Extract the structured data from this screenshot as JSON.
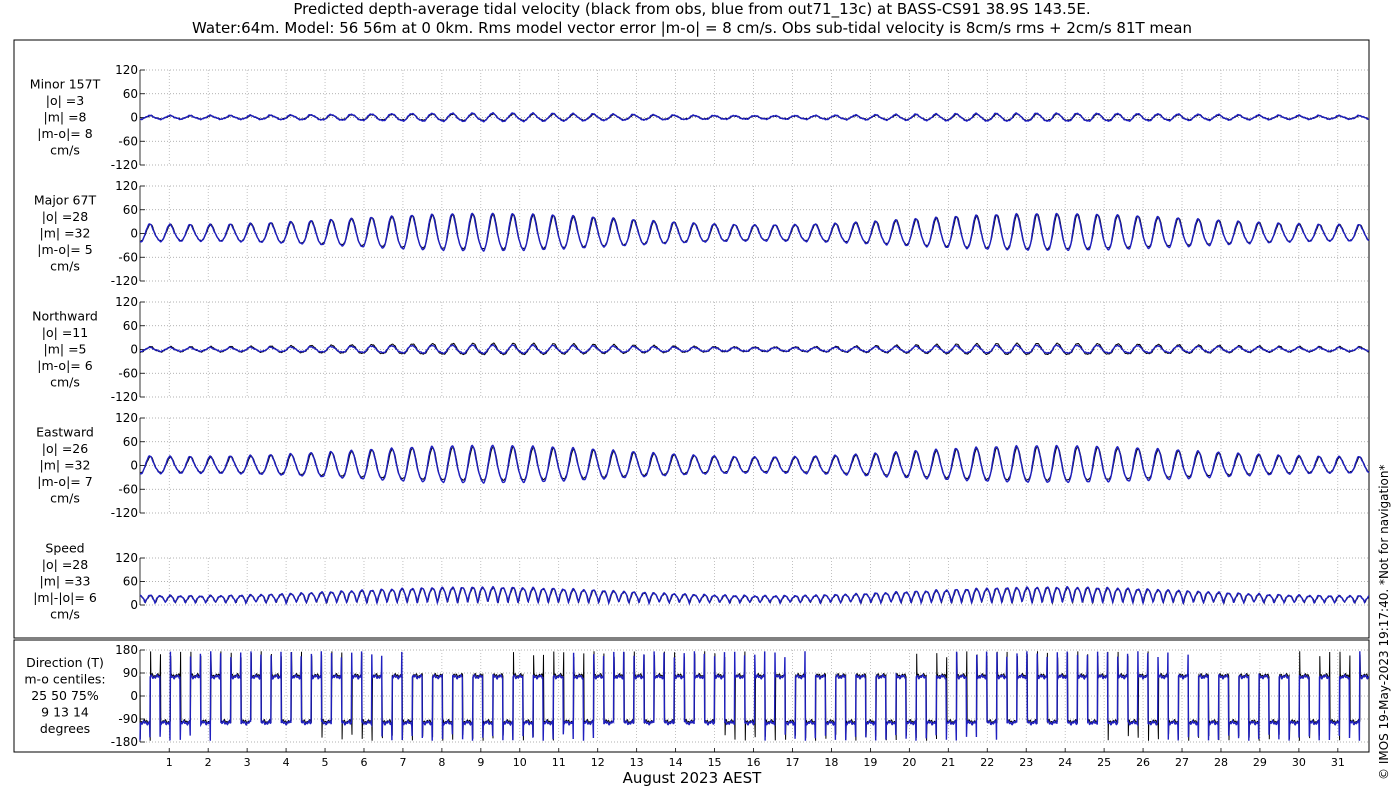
{
  "title_line1": "Predicted depth-average tidal velocity (black from obs, blue from out71_13c) at BASS-CS91 38.9S 143.5E.",
  "title_line2": "Water:64m. Model: 56 56m at 0 0km. Rms model vector error |m-o| = 8 cm/s. Obs sub-tidal velocity is 8cm/s rms + 2cm/s 81T mean",
  "xlabel": "August 2023 AEST",
  "x_ticks": [
    "1",
    "2",
    "3",
    "4",
    "5",
    "6",
    "7",
    "8",
    "9",
    "10",
    "11",
    "12",
    "13",
    "14",
    "15",
    "16",
    "17",
    "18",
    "19",
    "20",
    "21",
    "22",
    "23",
    "24",
    "25",
    "26",
    "27",
    "28",
    "29",
    "30",
    "31"
  ],
  "side_note": "© IMOS 19-May-2023 19:17:40.  *Not for navigation*",
  "colors": {
    "obs": "#000000",
    "model": "#1f1fbf",
    "grid": "#999999"
  },
  "chart_data": [
    {
      "type": "line",
      "label_lines": [
        "Minor 157T",
        "|o| =3",
        "|m| =8",
        "|m-o|= 8",
        "cm/s"
      ],
      "y_ticks": [
        "120",
        "60",
        "0",
        "-60",
        "-120"
      ],
      "ylim": [
        -120,
        120
      ],
      "x_range_days": [
        0.25,
        31.8
      ],
      "series": [
        {
          "name": "obs",
          "amplitude_cm_s": 8,
          "mean_cm_s": 0
        },
        {
          "name": "model",
          "amplitude_cm_s": 10,
          "mean_cm_s": 0
        }
      ]
    },
    {
      "type": "line",
      "label_lines": [
        "Major 67T",
        "|o| =28",
        "|m| =32",
        "|m-o|= 5",
        "cm/s"
      ],
      "y_ticks": [
        "120",
        "60",
        "0",
        "-60",
        "-120"
      ],
      "ylim": [
        -120,
        120
      ],
      "x_range_days": [
        0.25,
        31.8
      ],
      "series": [
        {
          "name": "obs",
          "amplitude_cm_s": 44,
          "mean_cm_s": 0
        },
        {
          "name": "model",
          "amplitude_cm_s": 46,
          "mean_cm_s": 0
        }
      ]
    },
    {
      "type": "line",
      "label_lines": [
        "Northward",
        "|o| =11",
        "|m| =5",
        "|m-o|= 6",
        "cm/s"
      ],
      "y_ticks": [
        "120",
        "60",
        "0",
        "-60",
        "-120"
      ],
      "ylim": [
        -120,
        120
      ],
      "x_range_days": [
        0.25,
        31.8
      ],
      "series": [
        {
          "name": "obs",
          "amplitude_cm_s": 14,
          "mean_cm_s": 0
        },
        {
          "name": "model",
          "amplitude_cm_s": 10,
          "mean_cm_s": 0
        }
      ]
    },
    {
      "type": "line",
      "label_lines": [
        "Eastward",
        "|o| =26",
        "|m| =32",
        "|m-o|= 7",
        "cm/s"
      ],
      "y_ticks": [
        "120",
        "60",
        "0",
        "-60",
        "-120"
      ],
      "ylim": [
        -120,
        120
      ],
      "x_range_days": [
        0.25,
        31.8
      ],
      "series": [
        {
          "name": "obs",
          "amplitude_cm_s": 42,
          "mean_cm_s": 0
        },
        {
          "name": "model",
          "amplitude_cm_s": 46,
          "mean_cm_s": 0
        }
      ]
    },
    {
      "type": "line",
      "label_lines": [
        "Speed",
        "|o| =28",
        "|m| =33",
        "|m|-|o|= 6",
        "cm/s"
      ],
      "y_ticks": [
        "120",
        "60",
        "0"
      ],
      "ylim": [
        0,
        120
      ],
      "x_range_days": [
        0.25,
        31.8
      ],
      "series": [
        {
          "name": "obs",
          "amplitude_cm_s": 44,
          "mean_cm_s": 0
        },
        {
          "name": "model",
          "amplitude_cm_s": 46,
          "mean_cm_s": 0
        }
      ]
    },
    {
      "type": "line",
      "label_lines": [
        "Direction (T)",
        "m-o centiles:",
        "25  50  75%",
        "9  13  14",
        "degrees"
      ],
      "y_ticks": [
        "180",
        "90",
        "0",
        "-90",
        "-180"
      ],
      "ylim": [
        -180,
        180
      ],
      "x_range_days": [
        0.25,
        31.8
      ],
      "series": [
        {
          "name": "obs",
          "flood_deg": 80,
          "ebb_deg": -100
        },
        {
          "name": "model",
          "flood_deg": 75,
          "ebb_deg": -105
        }
      ]
    }
  ]
}
